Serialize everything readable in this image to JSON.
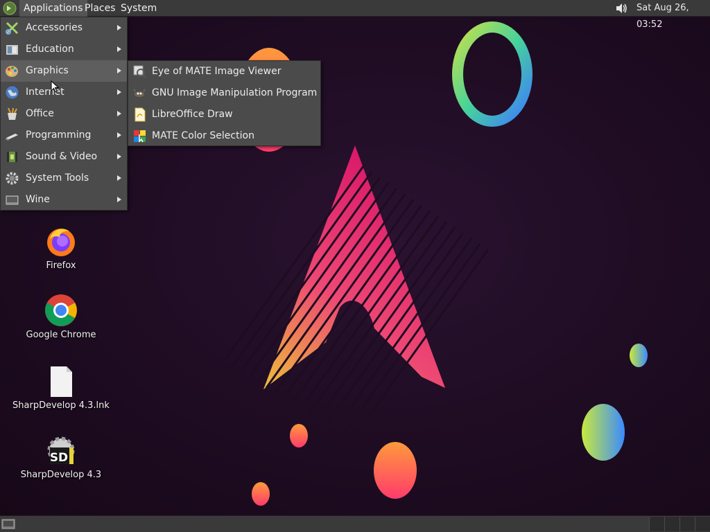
{
  "top_panel": {
    "applications_label": "Applications",
    "places_label": "Places",
    "system_label": "System",
    "clock": "Sat Aug 26, 03:52"
  },
  "app_menu": {
    "items": [
      {
        "label": "Accessories",
        "icon": "accessories-icon"
      },
      {
        "label": "Education",
        "icon": "education-icon"
      },
      {
        "label": "Graphics",
        "icon": "graphics-icon",
        "active": true
      },
      {
        "label": "Internet",
        "icon": "internet-icon"
      },
      {
        "label": "Office",
        "icon": "office-icon"
      },
      {
        "label": "Programming",
        "icon": "programming-icon"
      },
      {
        "label": "Sound & Video",
        "icon": "sound-video-icon"
      },
      {
        "label": "System Tools",
        "icon": "system-tools-icon"
      },
      {
        "label": "Wine",
        "icon": "wine-icon"
      }
    ]
  },
  "graphics_submenu": {
    "items": [
      {
        "label": "Eye of MATE Image Viewer",
        "icon": "image-viewer-icon"
      },
      {
        "label": "GNU Image Manipulation Program",
        "icon": "gimp-icon"
      },
      {
        "label": "LibreOffice Draw",
        "icon": "libreoffice-draw-icon"
      },
      {
        "label": "MATE Color Selection",
        "icon": "color-selection-icon"
      }
    ]
  },
  "desktop_icons": [
    {
      "label": "Firefox",
      "icon": "firefox-icon"
    },
    {
      "label": "Google Chrome",
      "icon": "chrome-icon"
    },
    {
      "label": "SharpDevelop 4.3.lnk",
      "icon": "file-icon"
    },
    {
      "label": "SharpDevelop 4.3",
      "icon": "sharpdevelop-icon",
      "icon_text": "SD"
    }
  ],
  "colors": {
    "panel": "#3a3a3a",
    "menu": "#4b4b4b",
    "menu_active": "#5e5e5e",
    "wallpaper": "#1e0c22"
  }
}
